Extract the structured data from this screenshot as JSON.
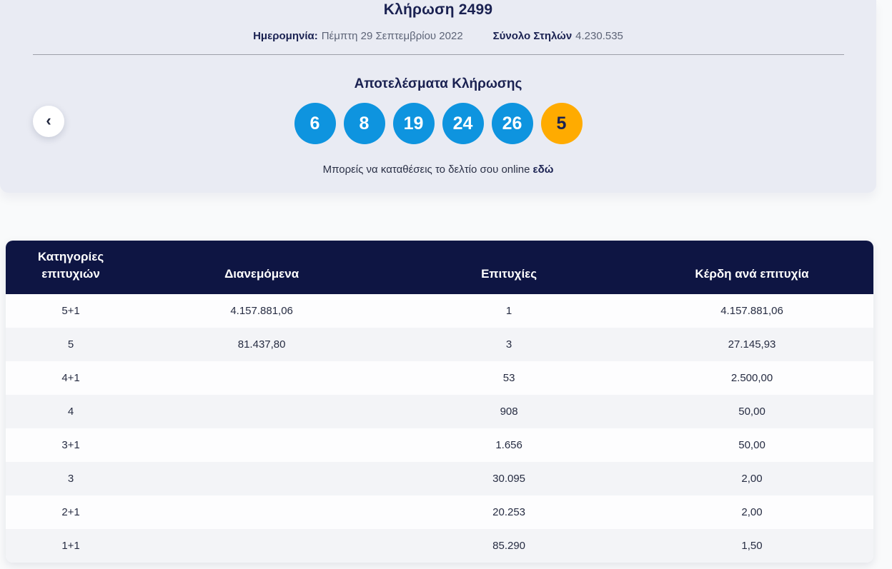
{
  "hero": {
    "title": "Κλήρωση 2499",
    "date_label": "Ημερομηνία:",
    "date_value": "Πέμπτη 29 Σεπτεμβρίου 2022",
    "total_columns_label": "Σύνολο Στηλών",
    "total_columns_value": "4.230.535",
    "results_title": "Αποτελέσματα Κλήρωσης",
    "numbers": [
      {
        "value": "6",
        "type": "main"
      },
      {
        "value": "8",
        "type": "main"
      },
      {
        "value": "19",
        "type": "main"
      },
      {
        "value": "24",
        "type": "main"
      },
      {
        "value": "26",
        "type": "main"
      },
      {
        "value": "5",
        "type": "joker"
      }
    ],
    "cta_text": "Μπορείς να καταθέσεις το δελτίο σου online",
    "cta_link_label": "εδώ",
    "prev_icon_glyph": "‹"
  },
  "table": {
    "headers": {
      "category": "Κατηγορίες επιτυχιών",
      "distributed": "Διανεμόμενα",
      "winners": "Επιτυχίες",
      "prize": "Κέρδη ανά επιτυχία"
    },
    "rows": [
      {
        "category": "5+1",
        "distributed": "4.157.881,06",
        "winners": "1",
        "prize": "4.157.881,06"
      },
      {
        "category": "5",
        "distributed": "81.437,80",
        "winners": "3",
        "prize": "27.145,93"
      },
      {
        "category": "4+1",
        "distributed": "",
        "winners": "53",
        "prize": "2.500,00"
      },
      {
        "category": "4",
        "distributed": "",
        "winners": "908",
        "prize": "50,00"
      },
      {
        "category": "3+1",
        "distributed": "",
        "winners": "1.656",
        "prize": "50,00"
      },
      {
        "category": "3",
        "distributed": "",
        "winners": "30.095",
        "prize": "2,00"
      },
      {
        "category": "2+1",
        "distributed": "",
        "winners": "20.253",
        "prize": "2,00"
      },
      {
        "category": "1+1",
        "distributed": "",
        "winners": "85.290",
        "prize": "1,50"
      }
    ]
  },
  "colors": {
    "hero_background": "#e9ebf3",
    "page_background": "#f9fafb",
    "main_number_ball": "#0e94df",
    "joker_number_ball": "#ffab00",
    "table_header_background": "#0e1543",
    "dark_navy_text": "#1a2151"
  }
}
